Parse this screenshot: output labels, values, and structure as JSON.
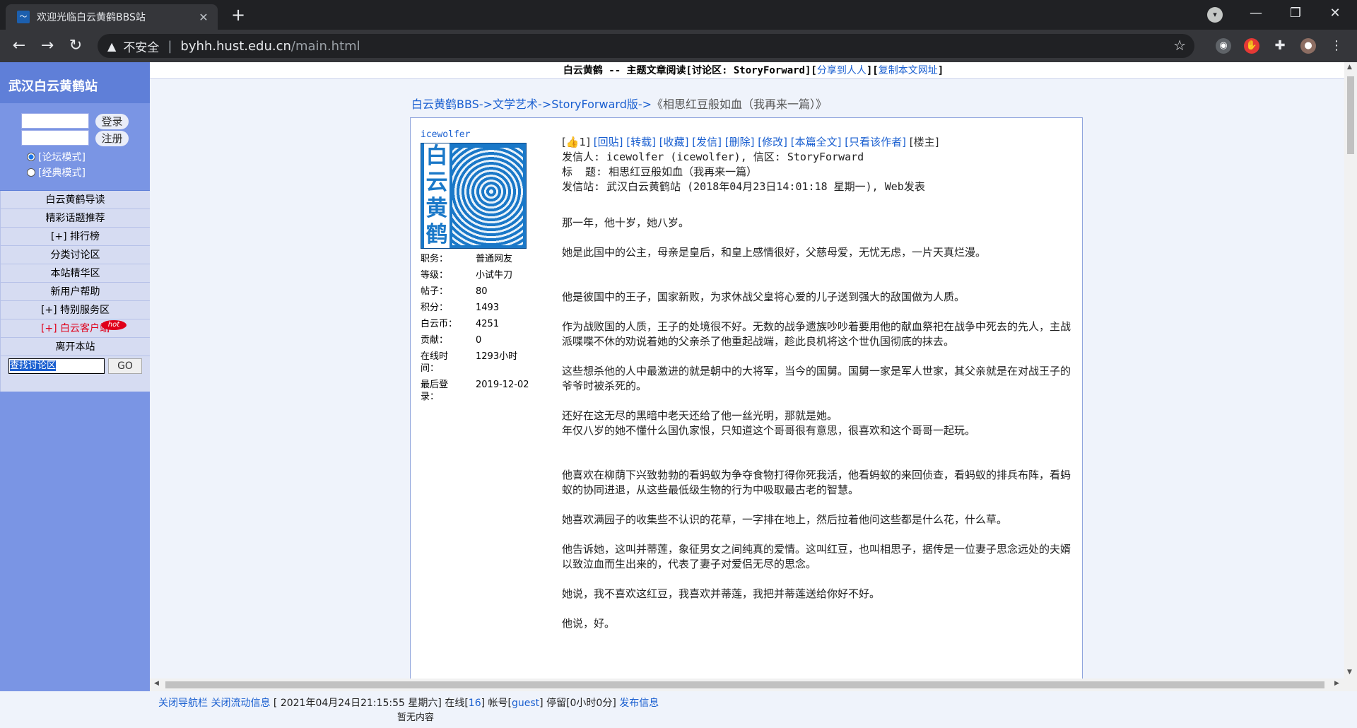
{
  "browser": {
    "tab_title": "欢迎光临白云黄鹤BBS站",
    "tab_close": "✕",
    "new_tab": "+",
    "insecure_label": "不安全",
    "url_host": "byhh.hust.edu.cn",
    "url_path": "/main.html"
  },
  "sidebar": {
    "site_title": "武汉白云黄鹤站",
    "login_button": "登录",
    "register_button": "注册",
    "mode_forum": "[论坛模式]",
    "mode_classic": "[经典模式]",
    "menu": [
      {
        "label": "白云黄鹤导读"
      },
      {
        "label": "精彩话题推荐"
      },
      {
        "label": "[+] 排行榜"
      },
      {
        "label": "分类讨论区"
      },
      {
        "label": "本站精华区"
      },
      {
        "label": "新用户帮助"
      },
      {
        "label": "[+] 特别服务区"
      },
      {
        "label": "[+] 白云客户端",
        "badge": "hot"
      },
      {
        "label": "离开本站"
      }
    ],
    "search_value": "查找讨论区",
    "go_button": "GO"
  },
  "topline": {
    "prefix": "白云黄鹤 -- 主题文章阅读[讨论区: StoryForward][",
    "share_link": "分享到人人",
    "middle": "][",
    "copy_link": "复制本文网址",
    "suffix": "]"
  },
  "breadcrumb": {
    "site": "白云黄鹤BBS",
    "sep": "->",
    "section": "文学艺术",
    "board": "StoryForward版",
    "title": "《相思红豆般如血（我再来一篇）》"
  },
  "author": {
    "id": "icewolfer",
    "avatar_text": "白云黄鹤",
    "stats": [
      {
        "k": "职务：",
        "v": "普通网友"
      },
      {
        "k": "等级：",
        "v": "小试牛刀"
      },
      {
        "k": "帖子：",
        "v": "80"
      },
      {
        "k": "积分：",
        "v": "1493"
      },
      {
        "k": "白云币：",
        "v": "4251"
      },
      {
        "k": "贡献：",
        "v": "0"
      },
      {
        "k": "在线时间：",
        "v": "1293小时"
      },
      {
        "k": "最后登录：",
        "v": "2019-12-02"
      }
    ]
  },
  "actions": {
    "like": "[👍1]",
    "reply": "[回贴]",
    "forward": "[转载]",
    "favorite": "[收藏]",
    "mail": "[发信]",
    "delete": "[删除]",
    "edit": "[修改]",
    "full": "[本篇全文]",
    "only_author": "[只看该作者]",
    "floor": "[楼主]"
  },
  "header": {
    "from": "发信人: icewolfer (icewolfer), 信区: StoryForward",
    "subject": "标  题: 相思红豆般如血（我再来一篇）",
    "site": "发信站: 武汉白云黄鹤站 (2018年04月23日14:01:18 星期一), Web发表"
  },
  "body": [
    "那一年，他十岁，她八岁。",
    "她是此国中的公主，母亲是皇后，和皇上感情很好，父慈母爱，无忧无虑，一片天真烂漫。",
    "他是彼国中的王子，国家新败，为求休战父皇将心爱的儿子送到强大的敌国做为人质。",
    "作为战败国的人质，王子的处境很不好。无数的战争遗族吵吵着要用他的献血祭祀在战争中死去的先人，主战派喋喋不休的劝说着她的父亲杀了他重起战端，趁此良机将这个世仇国彻底的抹去。",
    "这些想杀他的人中最激进的就是朝中的大将军，当今的国舅。国舅一家是军人世家，其父亲就是在对战王子的爷爷时被杀死的。",
    "还好在这无尽的黑暗中老天还给了他一丝光明，那就是她。",
    "年仅八岁的她不懂什么国仇家恨，只知道这个哥哥很有意思，很喜欢和这个哥哥一起玩。",
    "他喜欢在柳荫下兴致勃勃的看蚂蚁为争夺食物打得你死我活，他看蚂蚁的来回侦查，看蚂蚁的排兵布阵，看蚂蚁的协同进退，从这些最低级生物的行为中吸取最古老的智慧。",
    "她喜欢满园子的收集些不认识的花草，一字排在地上，然后拉着他问这些都是什么花，什么草。",
    "他告诉她，这叫并蒂莲，象征男女之间纯真的爱情。这叫红豆，也叫相思子，据传是一位妻子思念远处的夫婿以致泣血而生出来的，代表了妻子对爱侣无尽的思念。",
    "她说，我不喜欢这红豆，我喜欢并蒂莲，我把并蒂莲送给你好不好。",
    "他说，好。"
  ],
  "status": {
    "close_nav": "关闭导航栏",
    "close_flow": "关闭流动信息",
    "time": "[ 2021年04月24日21:15:55 星期六]",
    "online_label": "在线[",
    "online_count": "16",
    "account_label": "] 帐号[",
    "account": "guest",
    "stay": "] 停留[0小时0分]",
    "publish": "发布信息",
    "empty": "暂无内容"
  }
}
